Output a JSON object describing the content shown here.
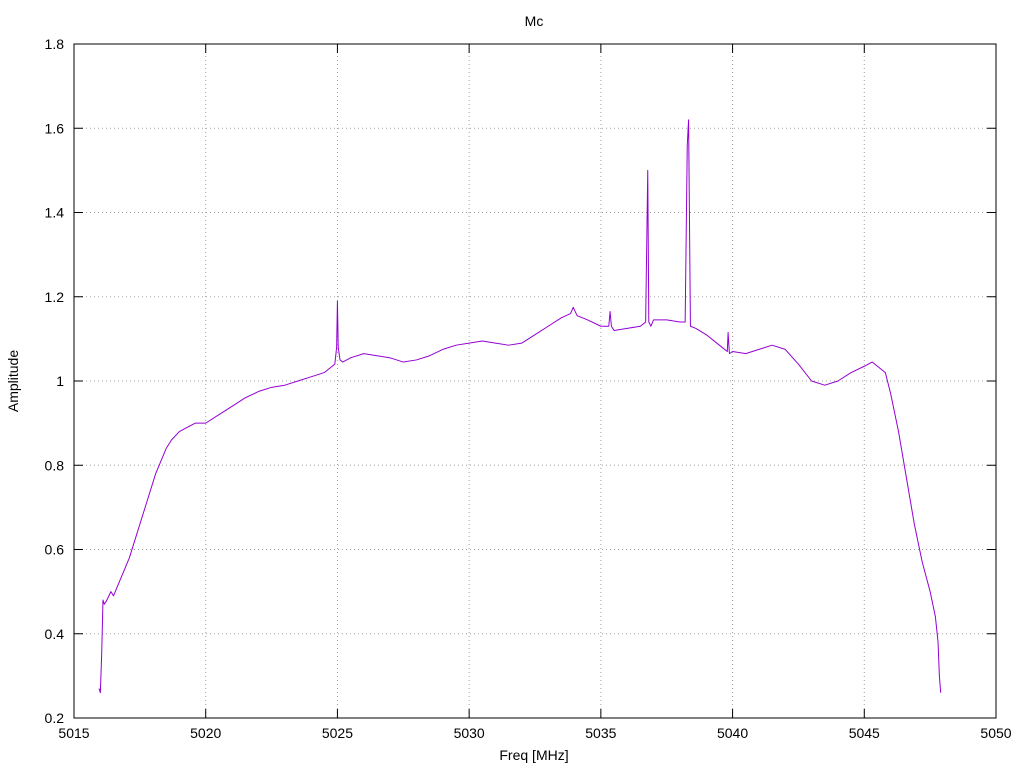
{
  "chart_data": {
    "type": "line",
    "title": "Mc",
    "xlabel": "Freq [MHz]",
    "ylabel": "Amplitude",
    "xlim": [
      5015,
      5050
    ],
    "ylim": [
      0.2,
      1.8
    ],
    "xticks": [
      5015,
      5020,
      5025,
      5030,
      5035,
      5040,
      5045,
      5050
    ],
    "yticks": [
      0.2,
      0.4,
      0.6,
      0.8,
      1.0,
      1.2,
      1.4,
      1.6,
      1.8
    ],
    "ytick_labels": [
      "0.2",
      "0.4",
      "0.6",
      "0.8",
      "1",
      "1.2",
      "1.4",
      "1.6",
      "1.8"
    ],
    "grid": true,
    "series": [
      {
        "color": "#9400d3",
        "x": [
          5015.95,
          5016.0,
          5016.05,
          5016.1,
          5016.15,
          5016.25,
          5016.4,
          5016.5,
          5016.7,
          5016.9,
          5017.1,
          5017.3,
          5017.5,
          5017.7,
          5017.9,
          5018.1,
          5018.3,
          5018.5,
          5018.7,
          5019.0,
          5019.3,
          5019.6,
          5020.0,
          5020.5,
          5021.0,
          5021.5,
          5022.0,
          5022.5,
          5023.0,
          5023.5,
          5024.0,
          5024.5,
          5024.9,
          5024.97,
          5025.0,
          5025.03,
          5025.1,
          5025.2,
          5025.5,
          5026.0,
          5026.5,
          5027.0,
          5027.5,
          5028.0,
          5028.5,
          5029.0,
          5029.5,
          5030.0,
          5030.5,
          5031.0,
          5031.5,
          5032.0,
          5032.5,
          5033.0,
          5033.5,
          5033.85,
          5033.95,
          5034.1,
          5034.5,
          5035.0,
          5035.3,
          5035.35,
          5035.4,
          5035.5,
          5036.0,
          5036.5,
          5036.7,
          5036.78,
          5036.82,
          5036.9,
          5037.0,
          5037.5,
          5038.0,
          5038.2,
          5038.28,
          5038.33,
          5038.4,
          5038.6,
          5039.0,
          5039.5,
          5039.8,
          5039.83,
          5039.88,
          5040.0,
          5040.5,
          5041.0,
          5041.5,
          5042.0,
          5042.5,
          5043.0,
          5043.5,
          5044.0,
          5044.5,
          5045.0,
          5045.3,
          5045.5,
          5045.8,
          5046.0,
          5046.3,
          5046.6,
          5046.9,
          5047.2,
          5047.5,
          5047.7,
          5047.8,
          5047.85,
          5047.9
        ],
        "y": [
          0.27,
          0.26,
          0.35,
          0.48,
          0.47,
          0.48,
          0.5,
          0.49,
          0.52,
          0.55,
          0.58,
          0.62,
          0.66,
          0.7,
          0.74,
          0.78,
          0.81,
          0.84,
          0.86,
          0.88,
          0.89,
          0.9,
          0.9,
          0.92,
          0.94,
          0.96,
          0.975,
          0.985,
          0.99,
          1.0,
          1.01,
          1.02,
          1.04,
          1.08,
          1.19,
          1.08,
          1.05,
          1.045,
          1.055,
          1.065,
          1.06,
          1.055,
          1.045,
          1.05,
          1.06,
          1.075,
          1.085,
          1.09,
          1.095,
          1.09,
          1.085,
          1.09,
          1.11,
          1.13,
          1.15,
          1.16,
          1.175,
          1.155,
          1.145,
          1.13,
          1.13,
          1.165,
          1.13,
          1.12,
          1.125,
          1.13,
          1.14,
          1.5,
          1.14,
          1.13,
          1.145,
          1.145,
          1.14,
          1.14,
          1.56,
          1.62,
          1.13,
          1.125,
          1.11,
          1.085,
          1.07,
          1.115,
          1.065,
          1.07,
          1.065,
          1.075,
          1.085,
          1.075,
          1.04,
          1.0,
          0.99,
          1.0,
          1.02,
          1.035,
          1.045,
          1.035,
          1.02,
          0.97,
          0.88,
          0.77,
          0.66,
          0.57,
          0.5,
          0.44,
          0.38,
          0.3,
          0.26
        ]
      }
    ]
  }
}
